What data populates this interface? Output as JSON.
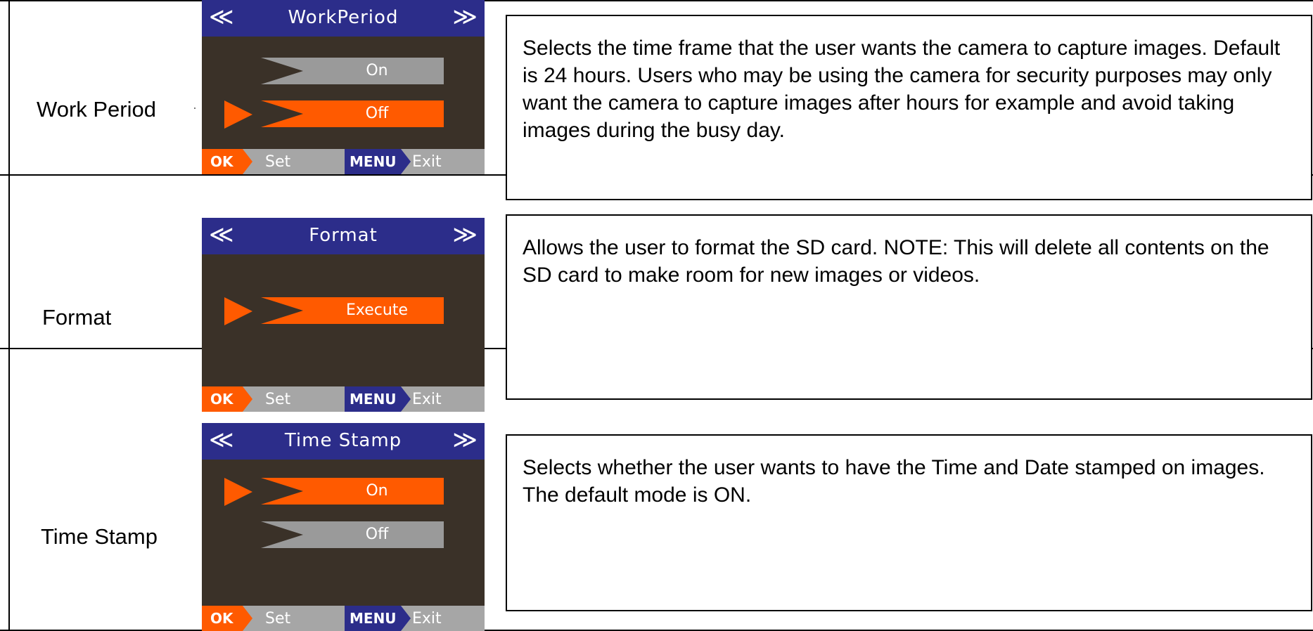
{
  "rows": [
    {
      "label": "Work  Period",
      "screen": {
        "title": "WorkPeriod",
        "left_arrow": "≪",
        "right_arrow": "≫",
        "options": [
          {
            "text": "On",
            "selected": false
          },
          {
            "text": "Off",
            "selected": true
          }
        ],
        "footer": {
          "ok": "OK",
          "set": "Set",
          "menu": "MENU",
          "exit": "Exit"
        }
      },
      "description": "Selects the time frame that the user wants the camera to capture images.  Default is 24 hours.  Users who may be using the camera for security purposes may only want the camera to capture images after hours for example and avoid taking images during the busy day."
    },
    {
      "label": "Format",
      "screen": {
        "title": "Format",
        "left_arrow": "≪",
        "right_arrow": "≫",
        "options": [
          {
            "text": "Execute",
            "selected": true
          }
        ],
        "footer": {
          "ok": "OK",
          "set": "Set",
          "menu": "MENU",
          "exit": "Exit"
        }
      },
      "description": "Allows the user to format the SD card.  NOTE:  This will delete all contents on the SD card to make room for new images or videos."
    },
    {
      "label": "Time Stamp",
      "screen": {
        "title": "Time Stamp",
        "left_arrow": "≪",
        "right_arrow": "≫",
        "options": [
          {
            "text": "On",
            "selected": true
          },
          {
            "text": "Off",
            "selected": false
          }
        ],
        "footer": {
          "ok": "OK",
          "set": "Set",
          "menu": "MENU",
          "exit": "Exit"
        }
      },
      "description": "Selects whether the user wants to have the Time and Date stamped on images.  The default mode is ON."
    }
  ],
  "colors": {
    "title_bar": "#2c2d8a",
    "screen_bg": "#3a3128",
    "selected": "#ff5a00",
    "unselected": "#9a9a9a",
    "footer": "#a6a6a6"
  }
}
